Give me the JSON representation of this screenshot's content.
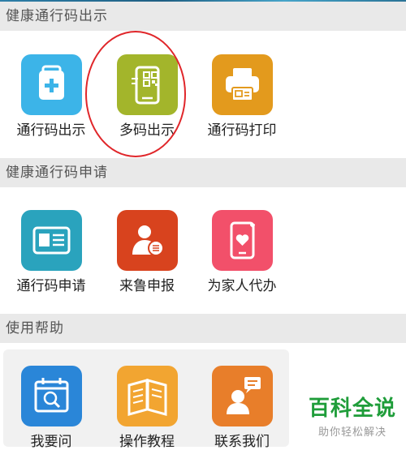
{
  "sections": [
    {
      "title": "健康通行码出示",
      "tiles": [
        {
          "label": "通行码出示",
          "icon": "id-card-plus-icon",
          "color": "#3cb4e8"
        },
        {
          "label": "多码出示",
          "icon": "phone-qr-icon",
          "color": "#a3b52b"
        },
        {
          "label": "通行码打印",
          "icon": "printer-icon",
          "color": "#e39a1d"
        }
      ]
    },
    {
      "title": "健康通行码申请",
      "tiles": [
        {
          "label": "通行码申请",
          "icon": "id-card-icon",
          "color": "#2aa3bd"
        },
        {
          "label": "来鲁申报",
          "icon": "person-report-icon",
          "color": "#d8431e"
        },
        {
          "label": "为家人代办",
          "icon": "phone-heart-icon",
          "color": "#f2506a"
        }
      ]
    },
    {
      "title": "使用帮助",
      "tiles": [
        {
          "label": "我要问",
          "icon": "calendar-search-icon",
          "color": "#2a86d8"
        },
        {
          "label": "操作教程",
          "icon": "book-icon",
          "color": "#f2a531"
        },
        {
          "label": "联系我们",
          "icon": "chat-person-icon",
          "color": "#e87e2a"
        }
      ]
    }
  ],
  "watermark": {
    "brand": "百科全说",
    "slogan": "助你轻松解决"
  }
}
